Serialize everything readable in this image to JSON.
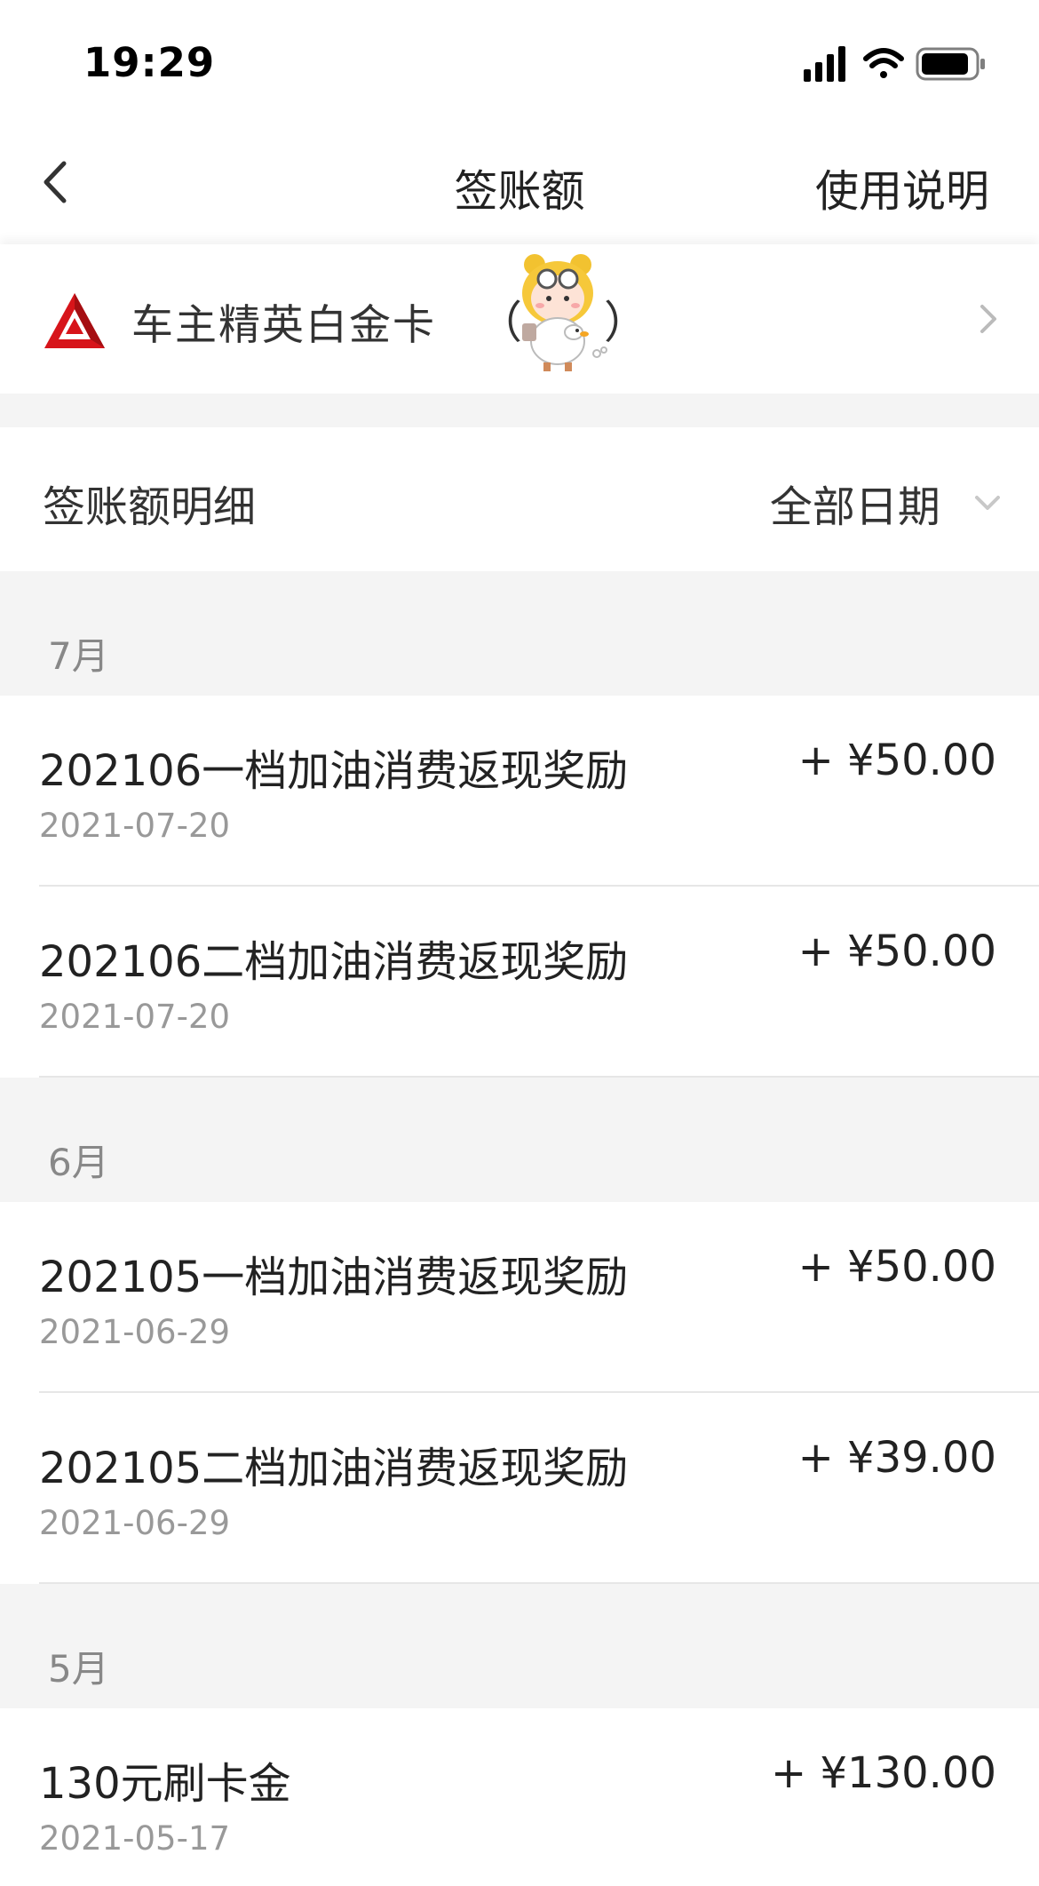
{
  "status_bar": {
    "time": "19:29"
  },
  "nav": {
    "title": "签账额",
    "action": "使用说明"
  },
  "card": {
    "name": "车主精英白金卡",
    "paren_open": "（",
    "paren_close": "）",
    "brand_color": "#d7141a"
  },
  "detail": {
    "title": "签账额明细",
    "filter_label": "全部日期"
  },
  "months": [
    {
      "label": "7月",
      "items": [
        {
          "title": "202106一档加油消费返现奖励",
          "date": "2021-07-20",
          "amount": "+ ¥50.00"
        },
        {
          "title": "202106二档加油消费返现奖励",
          "date": "2021-07-20",
          "amount": "+ ¥50.00"
        }
      ]
    },
    {
      "label": "6月",
      "items": [
        {
          "title": "202105一档加油消费返现奖励",
          "date": "2021-06-29",
          "amount": "+ ¥50.00"
        },
        {
          "title": "202105二档加油消费返现奖励",
          "date": "2021-06-29",
          "amount": "+ ¥39.00"
        }
      ]
    },
    {
      "label": "5月",
      "items": [
        {
          "title": "130元刷卡金",
          "date": "2021-05-17",
          "amount": "+ ¥130.00"
        }
      ]
    }
  ],
  "icons": {
    "back": "chevron-left-icon",
    "card_arrow": "chevron-right-icon",
    "filter_arrow": "chevron-down-icon",
    "signal": "signal-icon",
    "wifi": "wifi-icon",
    "battery": "battery-icon",
    "bank_logo": "bank-logo-icon",
    "sticker": "cartoon-sticker"
  }
}
